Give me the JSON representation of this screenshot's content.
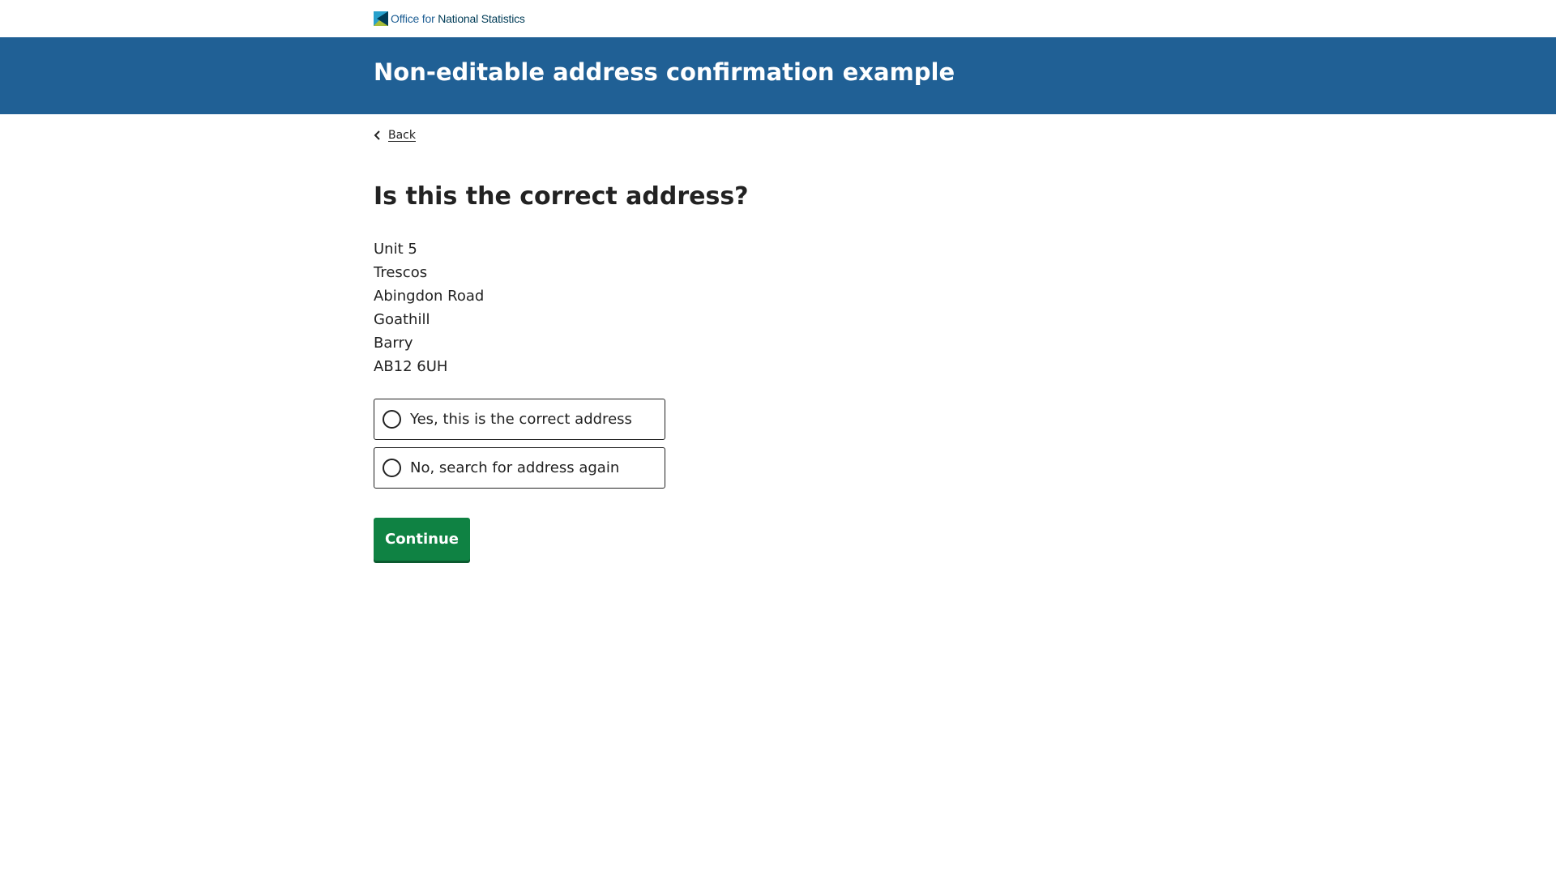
{
  "header": {
    "logo_text_light": "Office for",
    "logo_text_bold": "National Statistics",
    "title": "Non-editable address confirmation example"
  },
  "back_link": {
    "label": "Back"
  },
  "question": {
    "title": "Is this the correct address?"
  },
  "address": {
    "lines": [
      "Unit 5",
      "Trescos",
      "Abingdon Road",
      "Goathill",
      "Barry",
      "AB12 6UH"
    ]
  },
  "options": [
    {
      "label": "Yes, this is the correct address",
      "selected": false
    },
    {
      "label": "No, search for address again",
      "selected": false
    }
  ],
  "continue_button": {
    "label": "Continue"
  },
  "colors": {
    "brand_blue": "#206095",
    "button_green": "#0f8243",
    "text": "#222222"
  }
}
